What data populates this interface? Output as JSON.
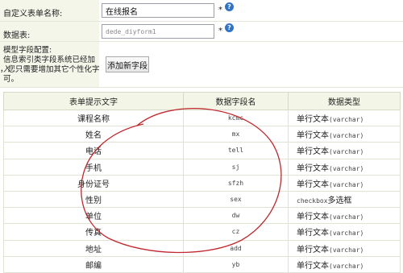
{
  "form": {
    "name_label": "自定义表单名称:",
    "name_value": "在线报名",
    "table_label": "数据表:",
    "table_value": "dede_diyform1",
    "required_mark": "*",
    "help_glyph": "?",
    "model_label_title": "模型字段配置:",
    "model_label_line1": "信息索引类字段系统已经加入",
    "model_label_line2": "，您只需要增加其它个性化字段即",
    "model_label_line3": "可。",
    "add_field_button": "添加新字段"
  },
  "table": {
    "headers": [
      "表单提示文字",
      "数据字段名",
      "数据类型"
    ],
    "rows": [
      {
        "label": "课程名称",
        "field": "kcmc",
        "type_text": "单行文本",
        "type_code": "(varchar)"
      },
      {
        "label": "姓名",
        "field": "mx",
        "type_text": "单行文本",
        "type_code": "(varchar)"
      },
      {
        "label": "电话",
        "field": "tell",
        "type_text": "单行文本",
        "type_code": "(varchar)"
      },
      {
        "label": "手机",
        "field": "sj",
        "type_text": "单行文本",
        "type_code": "(varchar)"
      },
      {
        "label": "身份证号",
        "field": "sfzh",
        "type_text": "单行文本",
        "type_code": "(varchar)"
      },
      {
        "label": "性别",
        "field": "sex",
        "type_text": "多选框",
        "type_code": "checkbox"
      },
      {
        "label": "单位",
        "field": "dw",
        "type_text": "单行文本",
        "type_code": "(varchar)"
      },
      {
        "label": "传真",
        "field": "cz",
        "type_text": "单行文本",
        "type_code": "(varchar)"
      },
      {
        "label": "地址",
        "field": "add",
        "type_text": "单行文本",
        "type_code": "(varchar)"
      },
      {
        "label": "邮编",
        "field": "yb",
        "type_text": "单行文本",
        "type_code": "(varchar)"
      }
    ]
  },
  "annotation_color": "#c0282e"
}
